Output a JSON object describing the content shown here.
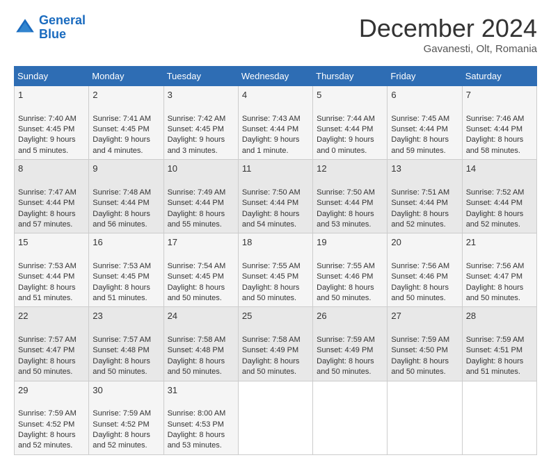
{
  "logo": {
    "line1": "General",
    "line2": "Blue"
  },
  "title": "December 2024",
  "subtitle": "Gavanesti, Olt, Romania",
  "days_of_week": [
    "Sunday",
    "Monday",
    "Tuesday",
    "Wednesday",
    "Thursday",
    "Friday",
    "Saturday"
  ],
  "weeks": [
    [
      {
        "day": "1",
        "sunrise": "Sunrise: 7:40 AM",
        "sunset": "Sunset: 4:45 PM",
        "daylight": "Daylight: 9 hours and 5 minutes."
      },
      {
        "day": "2",
        "sunrise": "Sunrise: 7:41 AM",
        "sunset": "Sunset: 4:45 PM",
        "daylight": "Daylight: 9 hours and 4 minutes."
      },
      {
        "day": "3",
        "sunrise": "Sunrise: 7:42 AM",
        "sunset": "Sunset: 4:45 PM",
        "daylight": "Daylight: 9 hours and 3 minutes."
      },
      {
        "day": "4",
        "sunrise": "Sunrise: 7:43 AM",
        "sunset": "Sunset: 4:44 PM",
        "daylight": "Daylight: 9 hours and 1 minute."
      },
      {
        "day": "5",
        "sunrise": "Sunrise: 7:44 AM",
        "sunset": "Sunset: 4:44 PM",
        "daylight": "Daylight: 9 hours and 0 minutes."
      },
      {
        "day": "6",
        "sunrise": "Sunrise: 7:45 AM",
        "sunset": "Sunset: 4:44 PM",
        "daylight": "Daylight: 8 hours and 59 minutes."
      },
      {
        "day": "7",
        "sunrise": "Sunrise: 7:46 AM",
        "sunset": "Sunset: 4:44 PM",
        "daylight": "Daylight: 8 hours and 58 minutes."
      }
    ],
    [
      {
        "day": "8",
        "sunrise": "Sunrise: 7:47 AM",
        "sunset": "Sunset: 4:44 PM",
        "daylight": "Daylight: 8 hours and 57 minutes."
      },
      {
        "day": "9",
        "sunrise": "Sunrise: 7:48 AM",
        "sunset": "Sunset: 4:44 PM",
        "daylight": "Daylight: 8 hours and 56 minutes."
      },
      {
        "day": "10",
        "sunrise": "Sunrise: 7:49 AM",
        "sunset": "Sunset: 4:44 PM",
        "daylight": "Daylight: 8 hours and 55 minutes."
      },
      {
        "day": "11",
        "sunrise": "Sunrise: 7:50 AM",
        "sunset": "Sunset: 4:44 PM",
        "daylight": "Daylight: 8 hours and 54 minutes."
      },
      {
        "day": "12",
        "sunrise": "Sunrise: 7:50 AM",
        "sunset": "Sunset: 4:44 PM",
        "daylight": "Daylight: 8 hours and 53 minutes."
      },
      {
        "day": "13",
        "sunrise": "Sunrise: 7:51 AM",
        "sunset": "Sunset: 4:44 PM",
        "daylight": "Daylight: 8 hours and 52 minutes."
      },
      {
        "day": "14",
        "sunrise": "Sunrise: 7:52 AM",
        "sunset": "Sunset: 4:44 PM",
        "daylight": "Daylight: 8 hours and 52 minutes."
      }
    ],
    [
      {
        "day": "15",
        "sunrise": "Sunrise: 7:53 AM",
        "sunset": "Sunset: 4:44 PM",
        "daylight": "Daylight: 8 hours and 51 minutes."
      },
      {
        "day": "16",
        "sunrise": "Sunrise: 7:53 AM",
        "sunset": "Sunset: 4:45 PM",
        "daylight": "Daylight: 8 hours and 51 minutes."
      },
      {
        "day": "17",
        "sunrise": "Sunrise: 7:54 AM",
        "sunset": "Sunset: 4:45 PM",
        "daylight": "Daylight: 8 hours and 50 minutes."
      },
      {
        "day": "18",
        "sunrise": "Sunrise: 7:55 AM",
        "sunset": "Sunset: 4:45 PM",
        "daylight": "Daylight: 8 hours and 50 minutes."
      },
      {
        "day": "19",
        "sunrise": "Sunrise: 7:55 AM",
        "sunset": "Sunset: 4:46 PM",
        "daylight": "Daylight: 8 hours and 50 minutes."
      },
      {
        "day": "20",
        "sunrise": "Sunrise: 7:56 AM",
        "sunset": "Sunset: 4:46 PM",
        "daylight": "Daylight: 8 hours and 50 minutes."
      },
      {
        "day": "21",
        "sunrise": "Sunrise: 7:56 AM",
        "sunset": "Sunset: 4:47 PM",
        "daylight": "Daylight: 8 hours and 50 minutes."
      }
    ],
    [
      {
        "day": "22",
        "sunrise": "Sunrise: 7:57 AM",
        "sunset": "Sunset: 4:47 PM",
        "daylight": "Daylight: 8 hours and 50 minutes."
      },
      {
        "day": "23",
        "sunrise": "Sunrise: 7:57 AM",
        "sunset": "Sunset: 4:48 PM",
        "daylight": "Daylight: 8 hours and 50 minutes."
      },
      {
        "day": "24",
        "sunrise": "Sunrise: 7:58 AM",
        "sunset": "Sunset: 4:48 PM",
        "daylight": "Daylight: 8 hours and 50 minutes."
      },
      {
        "day": "25",
        "sunrise": "Sunrise: 7:58 AM",
        "sunset": "Sunset: 4:49 PM",
        "daylight": "Daylight: 8 hours and 50 minutes."
      },
      {
        "day": "26",
        "sunrise": "Sunrise: 7:59 AM",
        "sunset": "Sunset: 4:49 PM",
        "daylight": "Daylight: 8 hours and 50 minutes."
      },
      {
        "day": "27",
        "sunrise": "Sunrise: 7:59 AM",
        "sunset": "Sunset: 4:50 PM",
        "daylight": "Daylight: 8 hours and 50 minutes."
      },
      {
        "day": "28",
        "sunrise": "Sunrise: 7:59 AM",
        "sunset": "Sunset: 4:51 PM",
        "daylight": "Daylight: 8 hours and 51 minutes."
      }
    ],
    [
      {
        "day": "29",
        "sunrise": "Sunrise: 7:59 AM",
        "sunset": "Sunset: 4:52 PM",
        "daylight": "Daylight: 8 hours and 52 minutes."
      },
      {
        "day": "30",
        "sunrise": "Sunrise: 7:59 AM",
        "sunset": "Sunset: 4:52 PM",
        "daylight": "Daylight: 8 hours and 52 minutes."
      },
      {
        "day": "31",
        "sunrise": "Sunrise: 8:00 AM",
        "sunset": "Sunset: 4:53 PM",
        "daylight": "Daylight: 8 hours and 53 minutes."
      },
      null,
      null,
      null,
      null
    ]
  ]
}
